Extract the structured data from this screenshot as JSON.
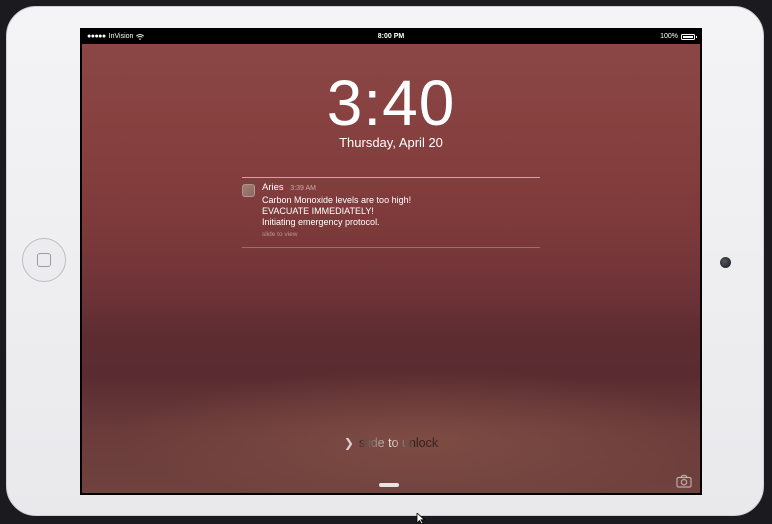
{
  "status_bar": {
    "signal": "●●●●●",
    "carrier": "InVision",
    "time": "8:00 PM",
    "battery": "100%",
    "battery_level": 1.0
  },
  "lock_screen": {
    "clock": "3:40",
    "date": "Thursday, April 20"
  },
  "notification": {
    "app": "Aries",
    "time": "3:39 AM",
    "lines": [
      "Carbon Monoxide levels are too high!",
      "EVACUATE IMMEDIATELY!",
      "Initiating emergency protocol."
    ],
    "action": "slide to view"
  },
  "unlock": {
    "label": "slide to unlock"
  },
  "icons": {
    "home": "home-button-icon",
    "camera": "camera-icon",
    "wifi": "wifi-icon",
    "battery": "battery-icon",
    "chevron": "chevron-right-icon"
  },
  "colors": {
    "wallpaper_top": "#8a4746",
    "wallpaper_mid": "#5c2c31",
    "device_frame": "#ececee",
    "text": "#ffffff"
  }
}
